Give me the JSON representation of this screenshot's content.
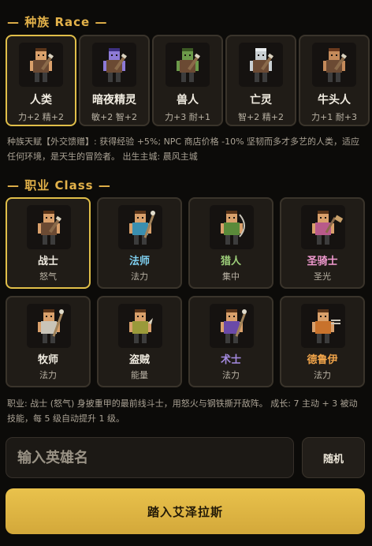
{
  "race_section": {
    "dash_left": "—",
    "title": "种族 Race",
    "dash_right": "—"
  },
  "races": [
    {
      "name": "人类",
      "bonus": "力+2 精+2",
      "icon": "human-warrior-icon",
      "selected": true,
      "skin": "#d9a06b",
      "hair": "#5a3419",
      "shirt": "#6b4a33",
      "pants": "#3c3c3c"
    },
    {
      "name": "暗夜精灵",
      "bonus": "敏+2 智+2",
      "icon": "night-elf-icon",
      "selected": false,
      "skin": "#8d7ad6",
      "hair": "#3d3080",
      "shirt": "#6b4a33",
      "pants": "#3c3c3c"
    },
    {
      "name": "兽人",
      "bonus": "力+3 耐+1",
      "icon": "orc-icon",
      "selected": false,
      "skin": "#6c9a4a",
      "hair": "#3c5a24",
      "shirt": "#6b4a33",
      "pants": "#3c3c3c"
    },
    {
      "name": "亡灵",
      "bonus": "智+2 精+2",
      "icon": "undead-icon",
      "selected": false,
      "skin": "#c9cfd2",
      "hair": "#e8ecee",
      "shirt": "#6b4a33",
      "pants": "#3c3c3c"
    },
    {
      "name": "牛头人",
      "bonus": "力+1 耐+3",
      "icon": "tauren-icon",
      "selected": false,
      "skin": "#c48a5a",
      "hair": "#6b3a1e",
      "shirt": "#6b4a33",
      "pants": "#3c3c3c"
    }
  ],
  "race_desc": "种族天赋【外交馈赠】: 获得经验 +5%; NPC 商店价格 -10%   坚韧而多才多艺的人类，适应任何环境，是天生的冒险者。   出生主城: 晨风主城",
  "class_section": {
    "dash_left": "—",
    "title": "职业 Class",
    "dash_right": "—"
  },
  "classes": [
    {
      "name": "战士",
      "resource": "怒气",
      "color": "#f0ebe0",
      "icon": "warrior-icon",
      "selected": true,
      "shirt": "#6b4a33",
      "weapon": "sword"
    },
    {
      "name": "法师",
      "resource": "法力",
      "color": "#7fd0f0",
      "icon": "mage-icon",
      "selected": false,
      "shirt": "#3a8fb0",
      "weapon": "staff"
    },
    {
      "name": "猎人",
      "resource": "集中",
      "color": "#9ed07a",
      "icon": "hunter-icon",
      "selected": false,
      "shirt": "#5a8a3a",
      "weapon": "bow"
    },
    {
      "name": "圣骑士",
      "resource": "圣光",
      "color": "#f29ad0",
      "icon": "paladin-icon",
      "selected": false,
      "shirt": "#b85a8a",
      "weapon": "hammer"
    },
    {
      "name": "牧师",
      "resource": "法力",
      "color": "#f0ebe0",
      "icon": "priest-icon",
      "selected": false,
      "shirt": "#c9c4b8",
      "weapon": "staff"
    },
    {
      "name": "盗贼",
      "resource": "能量",
      "color": "#f0ebe0",
      "icon": "rogue-icon",
      "selected": false,
      "shirt": "#9a9a3a",
      "weapon": "dagger"
    },
    {
      "name": "术士",
      "resource": "法力",
      "color": "#a48ae0",
      "icon": "warlock-icon",
      "selected": false,
      "shirt": "#6a4aa8",
      "weapon": "staff"
    },
    {
      "name": "德鲁伊",
      "resource": "法力",
      "color": "#f0a44a",
      "icon": "druid-icon",
      "selected": false,
      "shirt": "#c8722c",
      "weapon": "claw"
    }
  ],
  "class_desc": "职业: 战士 (怒气)   身披重甲的最前线斗士，用怒火与钢铁撕开敌阵。   成长: 7 主动 + 3 被动技能，每 5 级自动提升 1 级。",
  "name_input": {
    "placeholder": "输入英雄名",
    "value": ""
  },
  "random_button": "随机",
  "enter_button": "踏入艾泽拉斯",
  "colors": {
    "accent": "#e3b24a",
    "selected_border": "#e0be49",
    "button_gold": "#e9c24c",
    "card_bg": "#201c17"
  }
}
